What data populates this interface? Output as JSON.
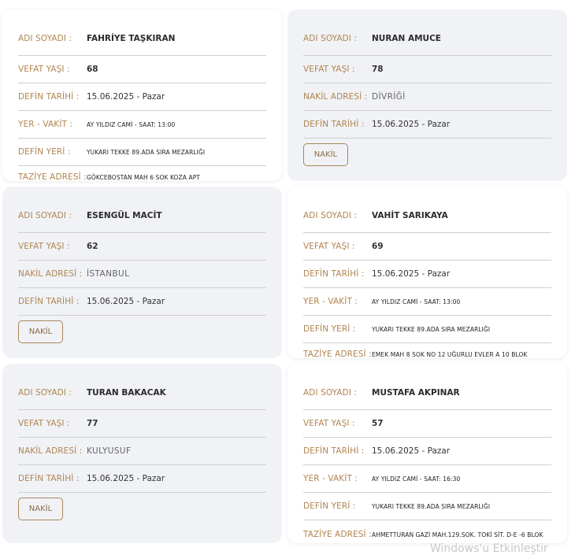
{
  "labels": {
    "name": "ADI SOYADI :",
    "age": "VEFAT YAŞI :",
    "burial_date": "DEFİN TARİHİ :",
    "place_time": "YER - VAKİT :",
    "burial_place": "DEFİN YERİ :",
    "condolence": "TAZİYE ADRESİ :",
    "transfer": "NAKİL ADRESİ :",
    "transfer_button": "NAKİL"
  },
  "cards": [
    {
      "name": "FAHRİYE TAŞKIRAN",
      "age": "68",
      "burial_date": "15.06.2025 - Pazar",
      "place_time": "AY YILDIZ CAMİ - SAAT: 13:00",
      "burial_place": "YUKARI TEKKE 89.ADA SIRA MEZARLIĞI",
      "condolence": "GÖKCEBOSTAN MAH 6 SOK KOZA APT"
    },
    {
      "name": "NURAN AMUCE",
      "age": "78",
      "transfer": "DİVRİĞİ",
      "burial_date": "15.06.2025 - Pazar"
    },
    {
      "name": "ESENGÜL MACİT",
      "age": "62",
      "transfer": "İSTANBUL",
      "burial_date": "15.06.2025 - Pazar"
    },
    {
      "name": "VAHİT SARIKAYA",
      "age": "69",
      "burial_date": "15.06.2025 - Pazar",
      "place_time": "AY YILDIZ CAMİ - SAAT: 13:00",
      "burial_place": "YUKARI TEKKE 89.ADA SIRA MEZARLIĞI",
      "condolence": "EMEK MAH 8 SOK NO 12 UĞURLU EVLER A 10 BLOK"
    },
    {
      "name": "TURAN BAKACAK",
      "age": "77",
      "transfer": "KULYUSUF",
      "burial_date": "15.06.2025 - Pazar"
    },
    {
      "name": "MUSTAFA AKPINAR",
      "age": "57",
      "burial_date": "15.06.2025 - Pazar",
      "place_time": "AY YILDIZ CAMİ - SAAT: 16:30",
      "burial_place": "YUKARI TEKKE 89.ADA SIRA MEZARLIĞI",
      "condolence": "AHMETTURAN GAZİ MAH.129.SOK. TOKİ SİT. D-E -6 BLOK"
    }
  ],
  "watermark": "Windows'u Etkinleştir"
}
